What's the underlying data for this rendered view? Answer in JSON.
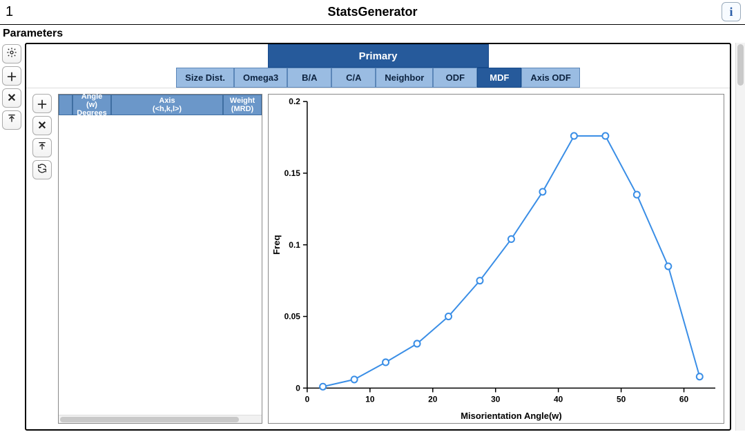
{
  "window": {
    "left_number": "1",
    "title": "StatsGenerator",
    "info_glyph": "i"
  },
  "panel_label": "Parameters",
  "primary_tab": "Primary",
  "sub_tabs": [
    {
      "label": "Size Dist.",
      "active": false
    },
    {
      "label": "Omega3",
      "active": false
    },
    {
      "label": "B/A",
      "active": false
    },
    {
      "label": "C/A",
      "active": false
    },
    {
      "label": "Neighbor",
      "active": false
    },
    {
      "label": "ODF",
      "active": false
    },
    {
      "label": "MDF",
      "active": true
    },
    {
      "label": "Axis ODF",
      "active": false
    }
  ],
  "table": {
    "columns": [
      {
        "line1": "Angle",
        "line2": "(w) Degrees"
      },
      {
        "line1": "Axis",
        "line2": "(<h,k,l>)"
      },
      {
        "line1": "Weight",
        "line2": "(MRD)"
      }
    ]
  },
  "chart_data": {
    "type": "line",
    "title": "",
    "xlabel": "Misorientation Angle(w)",
    "ylabel": "Freq",
    "xlim": [
      0,
      65
    ],
    "ylim": [
      0,
      0.2
    ],
    "xticks": [
      0,
      10,
      20,
      30,
      40,
      50,
      60
    ],
    "yticks": [
      0,
      0.05,
      0.1,
      0.15,
      0.2
    ],
    "x": [
      2.5,
      7.5,
      12.5,
      17.5,
      22.5,
      27.5,
      32.5,
      37.5,
      42.5,
      47.5,
      52.5,
      57.5,
      62.5
    ],
    "values": [
      0.001,
      0.006,
      0.018,
      0.031,
      0.05,
      0.075,
      0.104,
      0.137,
      0.176,
      0.176,
      0.135,
      0.085,
      0.008
    ]
  }
}
